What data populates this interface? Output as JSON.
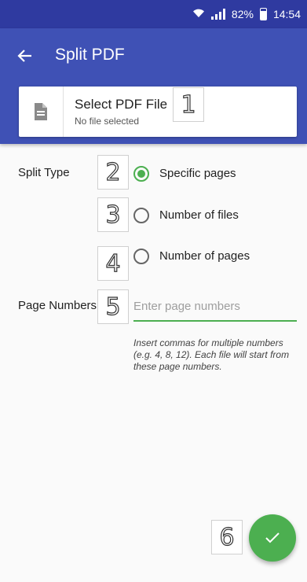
{
  "status_bar": {
    "battery": "82%",
    "time": "14:54"
  },
  "app_bar": {
    "title": "Split PDF"
  },
  "select_file": {
    "title": "Select PDF File",
    "subtitle": "No file selected"
  },
  "split_type": {
    "label": "Split Type",
    "options": [
      "Specific pages",
      "Number of files",
      "Number of pages"
    ],
    "selected": "Specific pages"
  },
  "page_numbers": {
    "label": "Page Numbers",
    "placeholder": "Enter page numbers",
    "value": "",
    "hint": "Insert commas for multiple numbers (e.g. 4, 8, 12). Each file will start from these page numbers."
  },
  "markers": [
    "1",
    "2",
    "3",
    "4",
    "5",
    "6"
  ],
  "colors": {
    "primary": "#3f51b5",
    "status_bar": "#2f3aa0",
    "accent": "#4caf50"
  },
  "icons": {
    "back": "arrow-left",
    "file": "document",
    "confirm": "check",
    "wifi": "wifi",
    "signal": "signal-bars",
    "battery": "battery"
  }
}
